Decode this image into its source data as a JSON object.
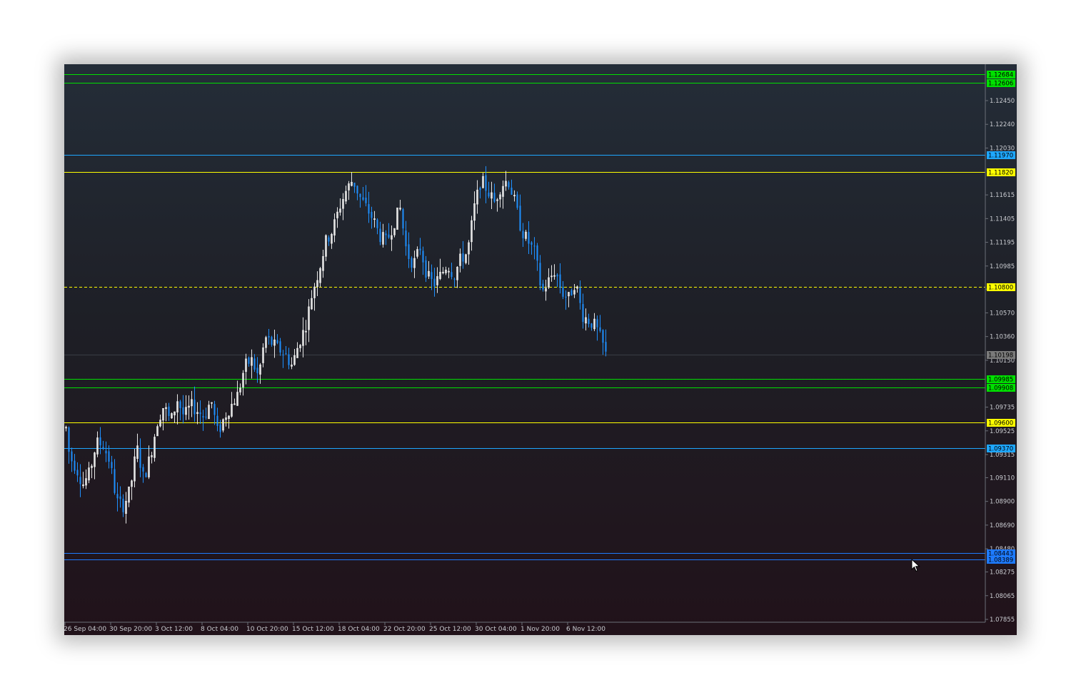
{
  "chart_data": {
    "type": "candlestick",
    "instrument": "",
    "grid": false,
    "colors": {
      "background_top": "#242d38",
      "background_bottom": "#21121a",
      "bull_candle": "#e6e6e6",
      "bear_candle": "#1e90ff",
      "axis_text": "#c9cbd0"
    },
    "y_axis": {
      "position": "right",
      "range": [
        1.0785,
        1.1285
      ],
      "ticks": [
        "1.12450",
        "1.12240",
        "1.12030",
        "1.11615",
        "1.11405",
        "1.11195",
        "1.10985",
        "1.10780",
        "1.10570",
        "1.10360",
        "1.10150",
        "1.09735",
        "1.09525",
        "1.09315",
        "1.09110",
        "1.08900",
        "1.08690",
        "1.08480",
        "1.08275",
        "1.08065",
        "1.07855"
      ]
    },
    "x_axis": {
      "ticks": [
        "26 Sep 04:00",
        "30 Sep 20:00",
        "3 Oct 12:00",
        "8 Oct 04:00",
        "10 Oct 20:00",
        "15 Oct 12:00",
        "18 Oct 04:00",
        "22 Oct 20:00",
        "25 Oct 12:00",
        "30 Oct 04:00",
        "1 Nov 20:00",
        "6 Nov 12:00"
      ]
    },
    "horizontal_levels": [
      {
        "price": 1.12684,
        "label": "1.12684",
        "color": "#00e000",
        "style": "solid"
      },
      {
        "price": 1.12606,
        "label": "1.12606",
        "color": "#00e000",
        "style": "solid"
      },
      {
        "price": 1.1197,
        "label": "1.11970",
        "color": "#1ea7ff",
        "style": "solid"
      },
      {
        "price": 1.1182,
        "label": "1.11820",
        "color": "#ffff00",
        "style": "solid"
      },
      {
        "price": 1.108,
        "label": "1.10800",
        "color": "#ffff00",
        "style": "dashed"
      },
      {
        "price": 1.10198,
        "label": "1.10198",
        "color": "#7a7a7a",
        "style": "current"
      },
      {
        "price": 1.09985,
        "label": "1.09985",
        "color": "#00e000",
        "style": "solid"
      },
      {
        "price": 1.09908,
        "label": "1.09908",
        "color": "#00e000",
        "style": "solid"
      },
      {
        "price": 1.096,
        "label": "1.09600",
        "color": "#ffff00",
        "style": "solid"
      },
      {
        "price": 1.0937,
        "label": "1.09370",
        "color": "#1ea7ff",
        "style": "solid"
      },
      {
        "price": 1.08443,
        "label": "1.08443",
        "color": "#1e7bff",
        "style": "solid"
      },
      {
        "price": 1.08389,
        "label": "1.08389",
        "color": "#1e7bff",
        "style": "solid"
      }
    ],
    "price_path": [
      [
        0,
        1.0955
      ],
      [
        1,
        1.093
      ],
      [
        3,
        1.092
      ],
      [
        5,
        1.0905
      ],
      [
        7,
        1.0915
      ],
      [
        9,
        1.0942
      ],
      [
        11,
        1.094
      ],
      [
        13,
        1.0925
      ],
      [
        15,
        1.089
      ],
      [
        17,
        1.0886
      ],
      [
        19,
        1.09
      ],
      [
        21,
        1.0938
      ],
      [
        23,
        1.091
      ],
      [
        25,
        1.093
      ],
      [
        27,
        1.096
      ],
      [
        29,
        1.0975
      ],
      [
        31,
        1.096
      ],
      [
        33,
        1.098
      ],
      [
        35,
        1.0965
      ],
      [
        37,
        1.0975
      ],
      [
        39,
        1.097
      ],
      [
        41,
        1.0965
      ],
      [
        43,
        1.098
      ],
      [
        45,
        1.095
      ],
      [
        47,
        1.0965
      ],
      [
        49,
        1.0975
      ],
      [
        51,
        1.0985
      ],
      [
        53,
        1.101
      ],
      [
        55,
        1.1015
      ],
      [
        57,
        1.1
      ],
      [
        59,
        1.1035
      ],
      [
        61,
        1.103
      ],
      [
        63,
        1.1025
      ],
      [
        65,
        1.102
      ],
      [
        67,
        1.101
      ],
      [
        69,
        1.103
      ],
      [
        71,
        1.1045
      ],
      [
        73,
        1.1075
      ],
      [
        75,
        1.1095
      ],
      [
        77,
        1.112
      ],
      [
        79,
        1.113
      ],
      [
        81,
        1.115
      ],
      [
        83,
        1.1165
      ],
      [
        85,
        1.1175
      ],
      [
        87,
        1.116
      ],
      [
        89,
        1.115
      ],
      [
        91,
        1.114
      ],
      [
        93,
        1.1125
      ],
      [
        95,
        1.112
      ],
      [
        97,
        1.1135
      ],
      [
        99,
        1.115
      ],
      [
        101,
        1.111
      ],
      [
        103,
        1.11
      ],
      [
        105,
        1.1115
      ],
      [
        107,
        1.109
      ],
      [
        109,
        1.1082
      ],
      [
        111,
        1.109
      ],
      [
        113,
        1.11
      ],
      [
        115,
        1.109
      ],
      [
        117,
        1.1105
      ],
      [
        119,
        1.111
      ],
      [
        121,
        1.115
      ],
      [
        123,
        1.1175
      ],
      [
        125,
        1.1165
      ],
      [
        127,
        1.1155
      ],
      [
        129,
        1.117
      ],
      [
        131,
        1.1175
      ],
      [
        133,
        1.1155
      ],
      [
        135,
        1.113
      ],
      [
        137,
        1.112
      ],
      [
        139,
        1.111
      ],
      [
        141,
        1.1075
      ],
      [
        143,
        1.1085
      ],
      [
        145,
        1.1095
      ],
      [
        147,
        1.1075
      ],
      [
        149,
        1.107
      ],
      [
        151,
        1.1085
      ],
      [
        153,
        1.1055
      ],
      [
        155,
        1.105
      ],
      [
        157,
        1.1045
      ],
      [
        159,
        1.103
      ],
      [
        160,
        1.102
      ]
    ]
  },
  "last_price": "1.10198"
}
